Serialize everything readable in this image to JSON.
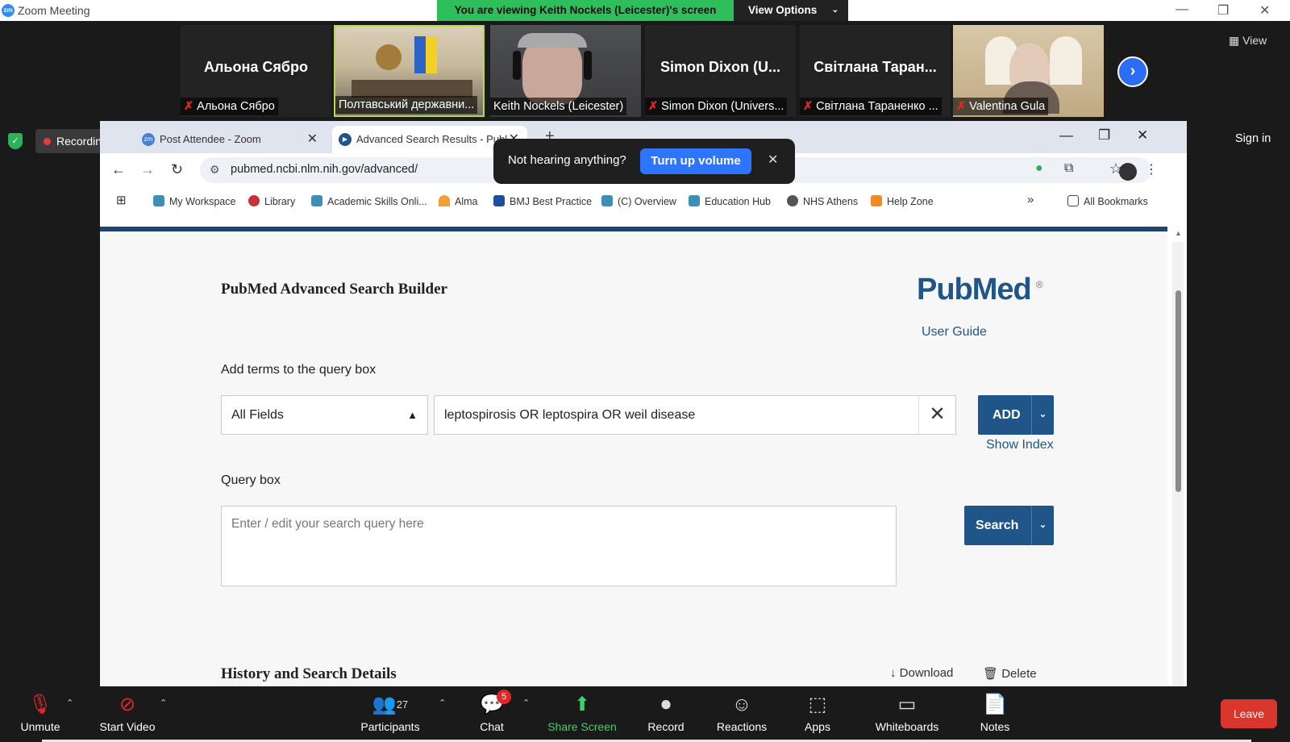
{
  "zoom": {
    "window_title": "Zoom Meeting",
    "viewing_banner": "You are viewing Keith Nockels (Leicester)'s screen",
    "view_options": "View Options",
    "view_label": "View",
    "sign_in": "Sign in",
    "recording_label": "Recording",
    "participants": [
      {
        "display": "Альона Сябро",
        "label": "Альона Сябро",
        "muted": true,
        "video": false
      },
      {
        "display": "",
        "label": "Полтавський державни...",
        "muted": false,
        "video": true
      },
      {
        "display": "",
        "label": "Keith Nockels (Leicester)",
        "muted": false,
        "video": true
      },
      {
        "display": "Simon Dixon (U...",
        "label": "Simon Dixon (Univers...",
        "muted": true,
        "video": false
      },
      {
        "display": "Світлана Таран...",
        "label": "Світлана Тараненко ...",
        "muted": true,
        "video": false
      },
      {
        "display": "",
        "label": "Valentina Gula",
        "muted": true,
        "video": true
      }
    ],
    "toolbar": {
      "unmute": "Unmute",
      "start_video": "Start Video",
      "participants": "Participants",
      "participants_count": "27",
      "chat": "Chat",
      "chat_badge": "5",
      "share_screen": "Share Screen",
      "record": "Record",
      "reactions": "Reactions",
      "apps": "Apps",
      "whiteboards": "Whiteboards",
      "notes": "Notes",
      "leave": "Leave"
    },
    "toast": {
      "message": "Not hearing anything?",
      "button": "Turn up volume"
    }
  },
  "browser": {
    "tabs": [
      {
        "title": "Post Attendee - Zoom",
        "active": false
      },
      {
        "title": "Advanced Search Results - Publ",
        "active": true
      }
    ],
    "url": "pubmed.ncbi.nlm.nih.gov/advanced/",
    "bookmarks": [
      "My Workspace",
      "Library",
      "Academic Skills Onli...",
      "Alma",
      "BMJ Best Practice",
      "(C) Overview",
      "Education Hub",
      "NHS Athens",
      "Help Zone"
    ],
    "all_bookmarks": "All Bookmarks"
  },
  "pubmed": {
    "title": "PubMed Advanced Search Builder",
    "logo": "PubMed",
    "user_guide": "User Guide",
    "add_terms_label": "Add terms to the query box",
    "field_select_value": "All Fields",
    "term_input_value": "leptospirosis OR leptospira OR weil disease",
    "add_button": "ADD",
    "show_index": "Show Index",
    "query_box_label": "Query box",
    "query_box_placeholder": "Enter / edit your search query here",
    "search_button": "Search",
    "history_heading": "History and Search Details",
    "download": "Download",
    "delete": "Delete"
  },
  "colors": {
    "zoom_green": "#2fbe5c",
    "pubmed_blue": "#20558a",
    "leave_red": "#d9362d",
    "toast_button": "#2d74ff"
  }
}
